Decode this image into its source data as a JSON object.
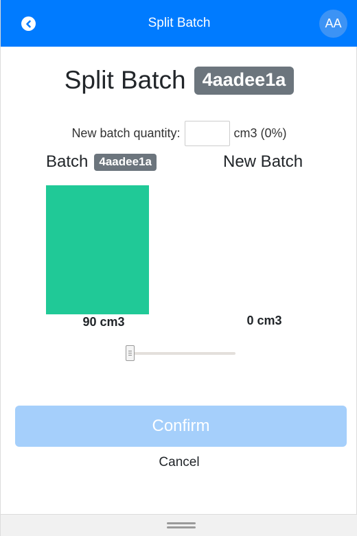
{
  "topbar": {
    "title": "Split Batch",
    "avatar_initials": "AA",
    "back_icon": "chevron-left-circle-icon",
    "color": "#007bff"
  },
  "heading": {
    "title": "Split Batch",
    "batch_id": "4aadee1a"
  },
  "quantity": {
    "label": "New batch quantity:",
    "value": "",
    "unit_suffix": "cm3 (0%)"
  },
  "columns": {
    "left_label": "Batch",
    "left_badge": "4aadee1a",
    "right_label": "New Batch",
    "left_amount": "90 cm3",
    "right_amount": "0 cm3",
    "left_fill_fraction": 1.0,
    "right_fill_fraction": 0.0,
    "bar_color": "#20c997"
  },
  "slider": {
    "fraction": 0.0
  },
  "actions": {
    "confirm_label": "Confirm",
    "cancel_label": "Cancel",
    "confirm_color": "#a5cffb"
  }
}
